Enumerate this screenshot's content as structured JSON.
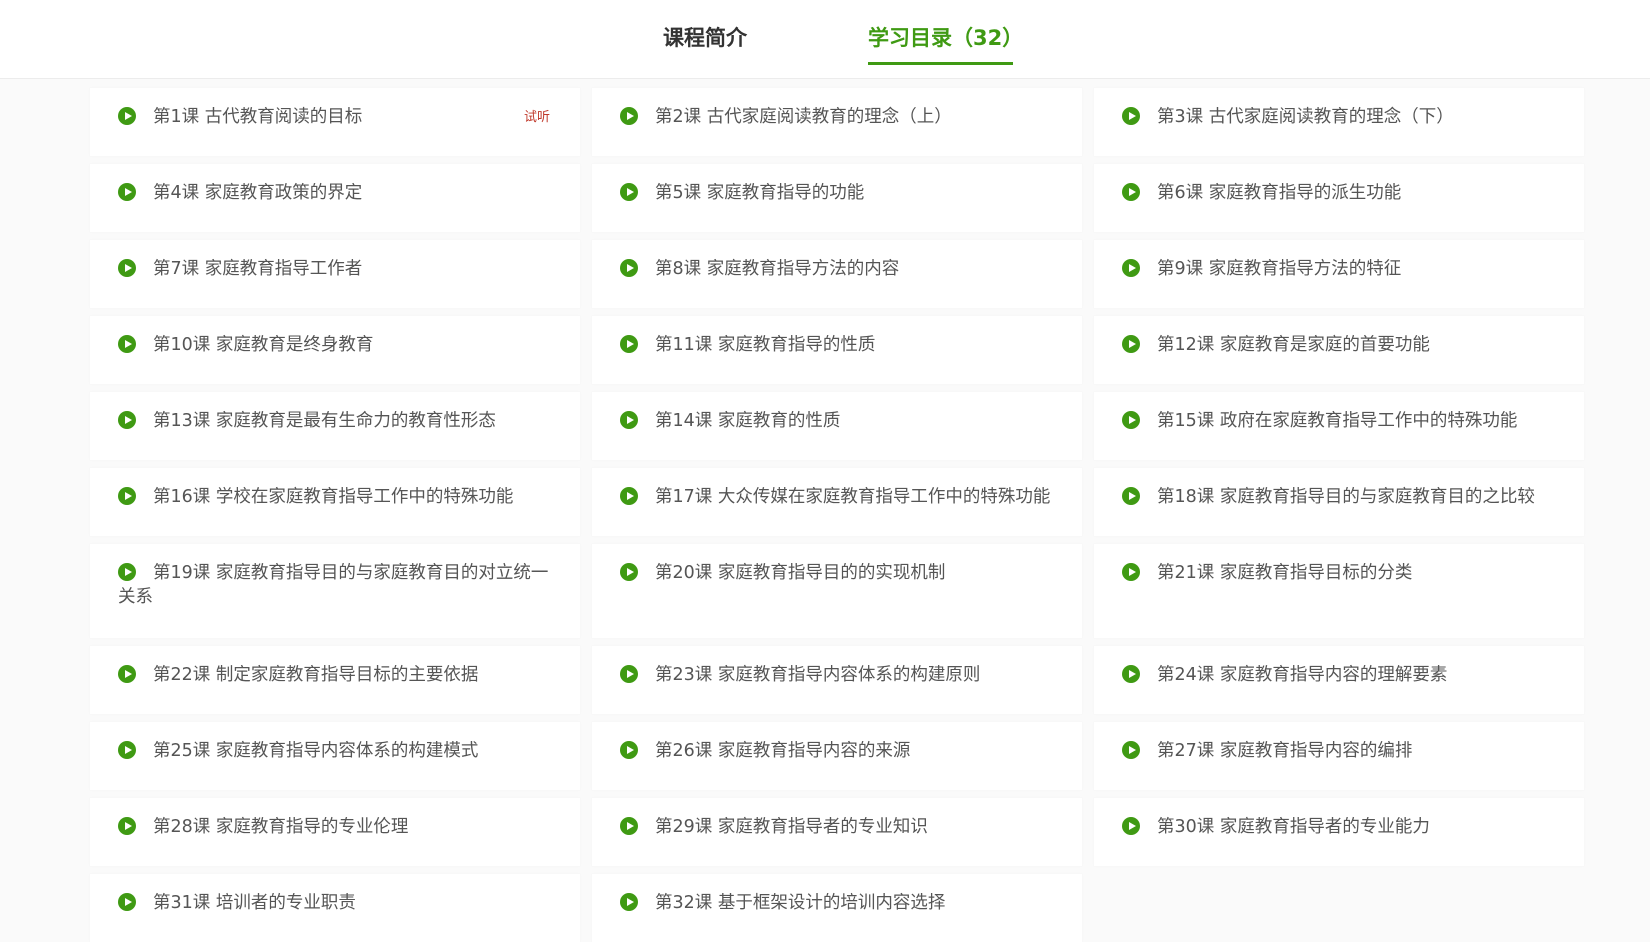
{
  "tabs": [
    {
      "label": "课程简介",
      "active": false
    },
    {
      "label": "学习目录（32）",
      "active": true
    }
  ],
  "colors": {
    "accent": "#3f9a13",
    "trial_badge": "#c0392b",
    "text": "#555555"
  },
  "icons": {
    "lesson": "play-circle-icon"
  },
  "lessons": [
    {
      "label": "第1课 古代教育阅读的目标",
      "badge": "试听"
    },
    {
      "label": "第2课 古代家庭阅读教育的理念（上）"
    },
    {
      "label": "第3课 古代家庭阅读教育的理念（下）"
    },
    {
      "label": "第4课 家庭教育政策的界定"
    },
    {
      "label": "第5课 家庭教育指导的功能"
    },
    {
      "label": "第6课 家庭教育指导的派生功能"
    },
    {
      "label": "第7课 家庭教育指导工作者"
    },
    {
      "label": "第8课 家庭教育指导方法的内容"
    },
    {
      "label": "第9课 家庭教育指导方法的特征"
    },
    {
      "label": "第10课 家庭教育是终身教育"
    },
    {
      "label": "第11课 家庭教育指导的性质"
    },
    {
      "label": "第12课 家庭教育是家庭的首要功能"
    },
    {
      "label": "第13课 家庭教育是最有生命力的教育性形态"
    },
    {
      "label": "第14课 家庭教育的性质"
    },
    {
      "label": "第15课 政府在家庭教育指导工作中的特殊功能"
    },
    {
      "label": "第16课 学校在家庭教育指导工作中的特殊功能"
    },
    {
      "label": "第17课 大众传媒在家庭教育指导工作中的特殊功能"
    },
    {
      "label": "第18课 家庭教育指导目的与家庭教育目的之比较"
    },
    {
      "label": "第19课 家庭教育指导目的与家庭教育目的对立统一关系"
    },
    {
      "label": "第20课 家庭教育指导目的的实现机制"
    },
    {
      "label": "第21课 家庭教育指导目标的分类"
    },
    {
      "label": "第22课 制定家庭教育指导目标的主要依据"
    },
    {
      "label": "第23课 家庭教育指导内容体系的构建原则"
    },
    {
      "label": "第24课 家庭教育指导内容的理解要素"
    },
    {
      "label": "第25课 家庭教育指导内容体系的构建模式"
    },
    {
      "label": "第26课 家庭教育指导内容的来源"
    },
    {
      "label": "第27课 家庭教育指导内容的编排"
    },
    {
      "label": "第28课 家庭教育指导的专业伦理"
    },
    {
      "label": "第29课 家庭教育指导者的专业知识"
    },
    {
      "label": "第30课 家庭教育指导者的专业能力"
    },
    {
      "label": "第31课 培训者的专业职责"
    },
    {
      "label": "第32课 基于框架设计的培训内容选择"
    }
  ]
}
